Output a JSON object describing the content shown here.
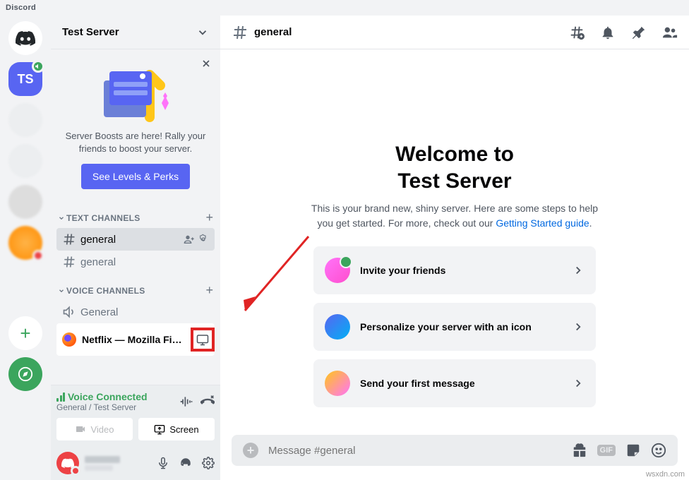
{
  "titlebar": "Discord",
  "server_rail": {
    "server_initials": "TS",
    "add_label": "+"
  },
  "sidebar": {
    "server_name": "Test Server",
    "boost": {
      "text": "Server Boosts are here! Rally your friends to boost your server.",
      "button": "See Levels & Perks"
    },
    "text_channels_label": "TEXT CHANNELS",
    "voice_channels_label": "VOICE CHANNELS",
    "channels": {
      "text": [
        {
          "name": "general",
          "selected": true
        },
        {
          "name": "general",
          "selected": false
        }
      ],
      "voice": [
        {
          "name": "General"
        }
      ]
    },
    "activity": "Netflix — Mozilla Firefox",
    "voice_status": {
      "label": "Voice Connected",
      "sub": "General / Test Server"
    },
    "video_btn": "Video",
    "screen_btn": "Screen"
  },
  "main": {
    "channel": "general",
    "welcome_title_1": "Welcome to",
    "welcome_title_2": "Test Server",
    "welcome_text": "This is your brand new, shiny server. Here are some steps to help you get started. For more, check out our ",
    "welcome_link": "Getting Started guide",
    "cards": [
      {
        "label": "Invite your friends",
        "icon": "invite"
      },
      {
        "label": "Personalize your server with an icon",
        "icon": "personalize"
      },
      {
        "label": "Send your first message",
        "icon": "send"
      }
    ],
    "message_placeholder": "Message #general",
    "gif_label": "GIF"
  },
  "watermark": "wsxdn.com"
}
